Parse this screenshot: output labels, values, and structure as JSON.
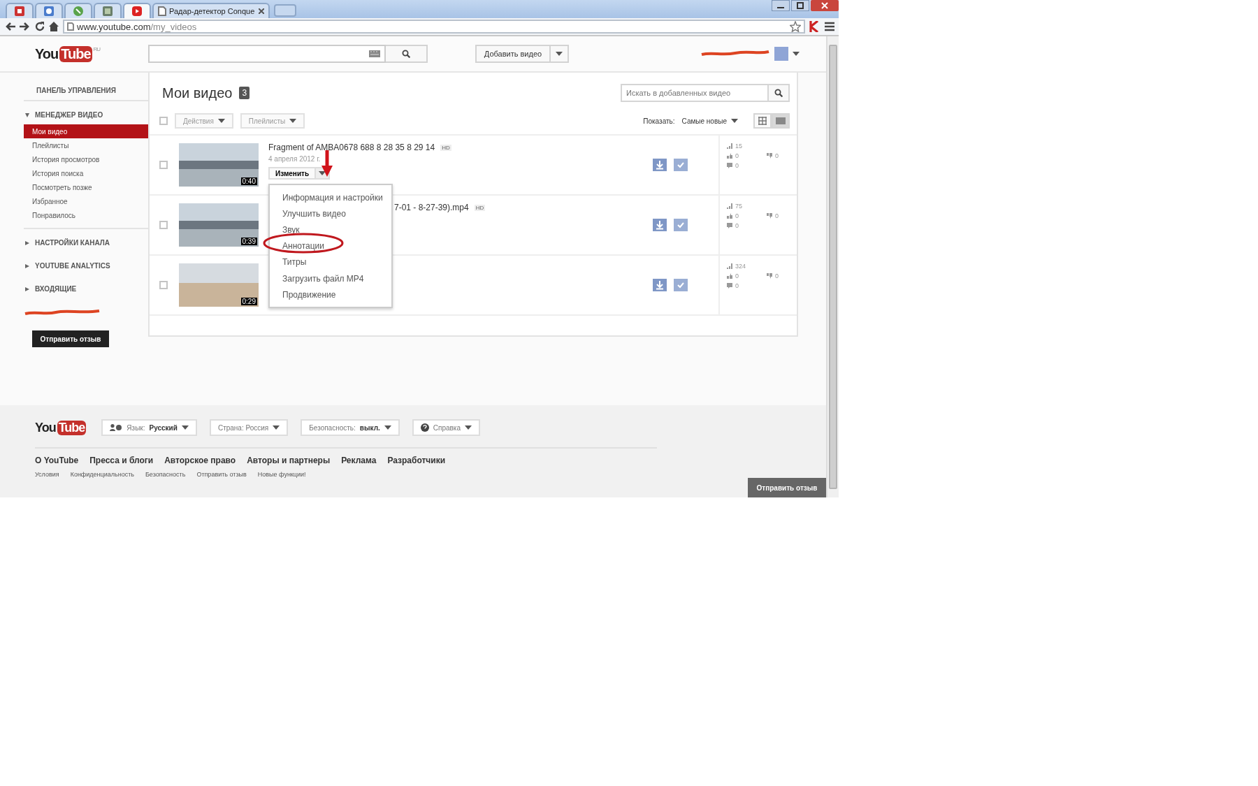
{
  "browser": {
    "tabs": [
      {
        "kind": "pinned",
        "selected": false
      },
      {
        "kind": "pinned",
        "selected": false
      },
      {
        "kind": "pinned",
        "selected": false
      },
      {
        "kind": "pinned",
        "selected": false
      },
      {
        "kind": "pinned",
        "selected": true
      },
      {
        "kind": "page",
        "title": "Радар-детектор Conque",
        "selected": false
      }
    ],
    "address": {
      "host": "www.youtube.com",
      "path": "/my_videos"
    }
  },
  "header": {
    "logo": {
      "you": "You",
      "tube": "Tube",
      "region": "RU"
    },
    "upload_button": "Добавить видео"
  },
  "sidebar": {
    "title": "ПАНЕЛЬ УПРАВЛЕНИЯ",
    "sections": [
      {
        "label": "МЕНЕДЖЕР ВИДЕО",
        "expanded": true,
        "items": [
          {
            "label": "Мои видео",
            "selected": true
          },
          {
            "label": "Плейлисты",
            "selected": false
          },
          {
            "label": "История просмотров",
            "selected": false
          },
          {
            "label": "История поиска",
            "selected": false
          },
          {
            "label": "Посмотреть позже",
            "selected": false
          },
          {
            "label": "Избранное",
            "selected": false
          },
          {
            "label": "Понравилось",
            "selected": false
          }
        ]
      },
      {
        "label": "НАСТРОЙКИ КАНАЛА",
        "expanded": false
      },
      {
        "label": "YOUTUBE ANALYTICS",
        "expanded": false
      },
      {
        "label": "ВХОДЯЩИЕ",
        "expanded": false
      }
    ],
    "feedback_button": "Отправить отзыв"
  },
  "main": {
    "title": "Мои видео",
    "count": "3",
    "select_all": {
      "checked": false
    },
    "actions": [
      "Действия",
      "Плейлисты"
    ],
    "search": {
      "placeholder": "Искать в добавленных видео"
    },
    "sort": {
      "label": "Показать:",
      "value": "Самые новые"
    },
    "view_modes": [
      {
        "kind": "grid",
        "selected": false
      },
      {
        "kind": "list",
        "selected": true
      }
    ],
    "videos": [
      {
        "kind": "full",
        "checked": false,
        "title": "Fragment of AMBA0678 688 8 28 35 8 29 14",
        "hd_badge": "HD",
        "date": "4 апреля 2012 г.",
        "duration": "0:40",
        "edit_button": "Изменить",
        "menu": {
          "open": true,
          "items": [
            "Информация и настройки",
            "Улучшить видео",
            "Звук",
            "Аннотации",
            "Титры",
            "Загрузить файл MP4",
            "Продвижение"
          ]
        },
        "views": "15",
        "likes": "0",
        "dislikes": "0",
        "comments": "0"
      },
      {
        "kind": "covered",
        "checked": false,
        "title": "7-01 - 8-27-39).mp4",
        "hd_badge": "HD",
        "duration": "0:39",
        "views": "75",
        "likes": "0",
        "dislikes": "0",
        "comments": "0"
      },
      {
        "kind": "covered",
        "checked": false,
        "duration": "0:29",
        "views": "324",
        "likes": "0",
        "dislikes": "0",
        "comments": "0"
      }
    ]
  },
  "footer": {
    "logo": {
      "you": "You",
      "tube": "Tube"
    },
    "controls": [
      {
        "kind": "language",
        "label": "Язык:",
        "value": "Русский"
      },
      {
        "kind": "select",
        "label": "Страна: Россия"
      },
      {
        "kind": "select",
        "label": "Безопасность:",
        "value": "выкл."
      },
      {
        "kind": "help",
        "label": "Справка"
      }
    ],
    "links": [
      "О YouTube",
      "Пресса и блоги",
      "Авторское право",
      "Авторы и партнеры",
      "Реклама",
      "Разработчики"
    ],
    "small_links": [
      "Условия",
      "Конфиденциальность",
      "Безопасность",
      "Отправить отзыв",
      "Новые функции!"
    ],
    "feedback_button": "Отправить отзыв"
  }
}
